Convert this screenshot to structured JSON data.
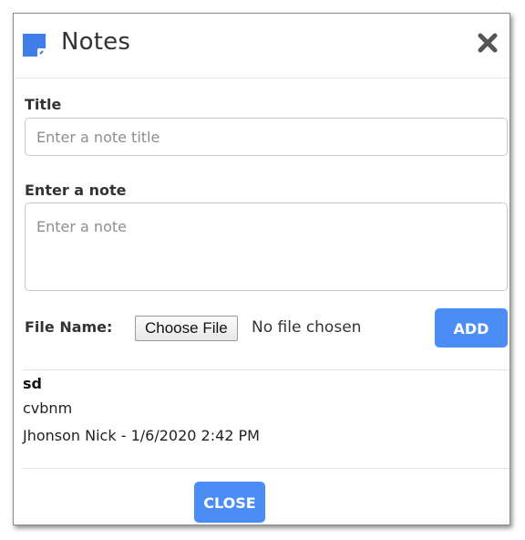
{
  "dialog": {
    "title": "Notes",
    "app_icon": "sticky-note-icon",
    "close_icon": "close-x-icon"
  },
  "form": {
    "title_label": "Title",
    "title_placeholder": "Enter a note title",
    "title_value": "",
    "note_label": "Enter a note",
    "note_placeholder": "Enter a note",
    "note_value": "",
    "file_label": "File Name:",
    "choose_file_label": "Choose File",
    "no_file_text": "No file chosen",
    "add_label": "ADD"
  },
  "notes": [
    {
      "title": "sd",
      "body": "cvbnm",
      "meta": "Jhonson Nick - 1/6/2020 2:42 PM"
    }
  ],
  "footer": {
    "close_label": "CLOSE"
  },
  "colors": {
    "accent": "#4a8df4",
    "icon_blue": "#3f7ee8",
    "close_x": "#555555"
  }
}
